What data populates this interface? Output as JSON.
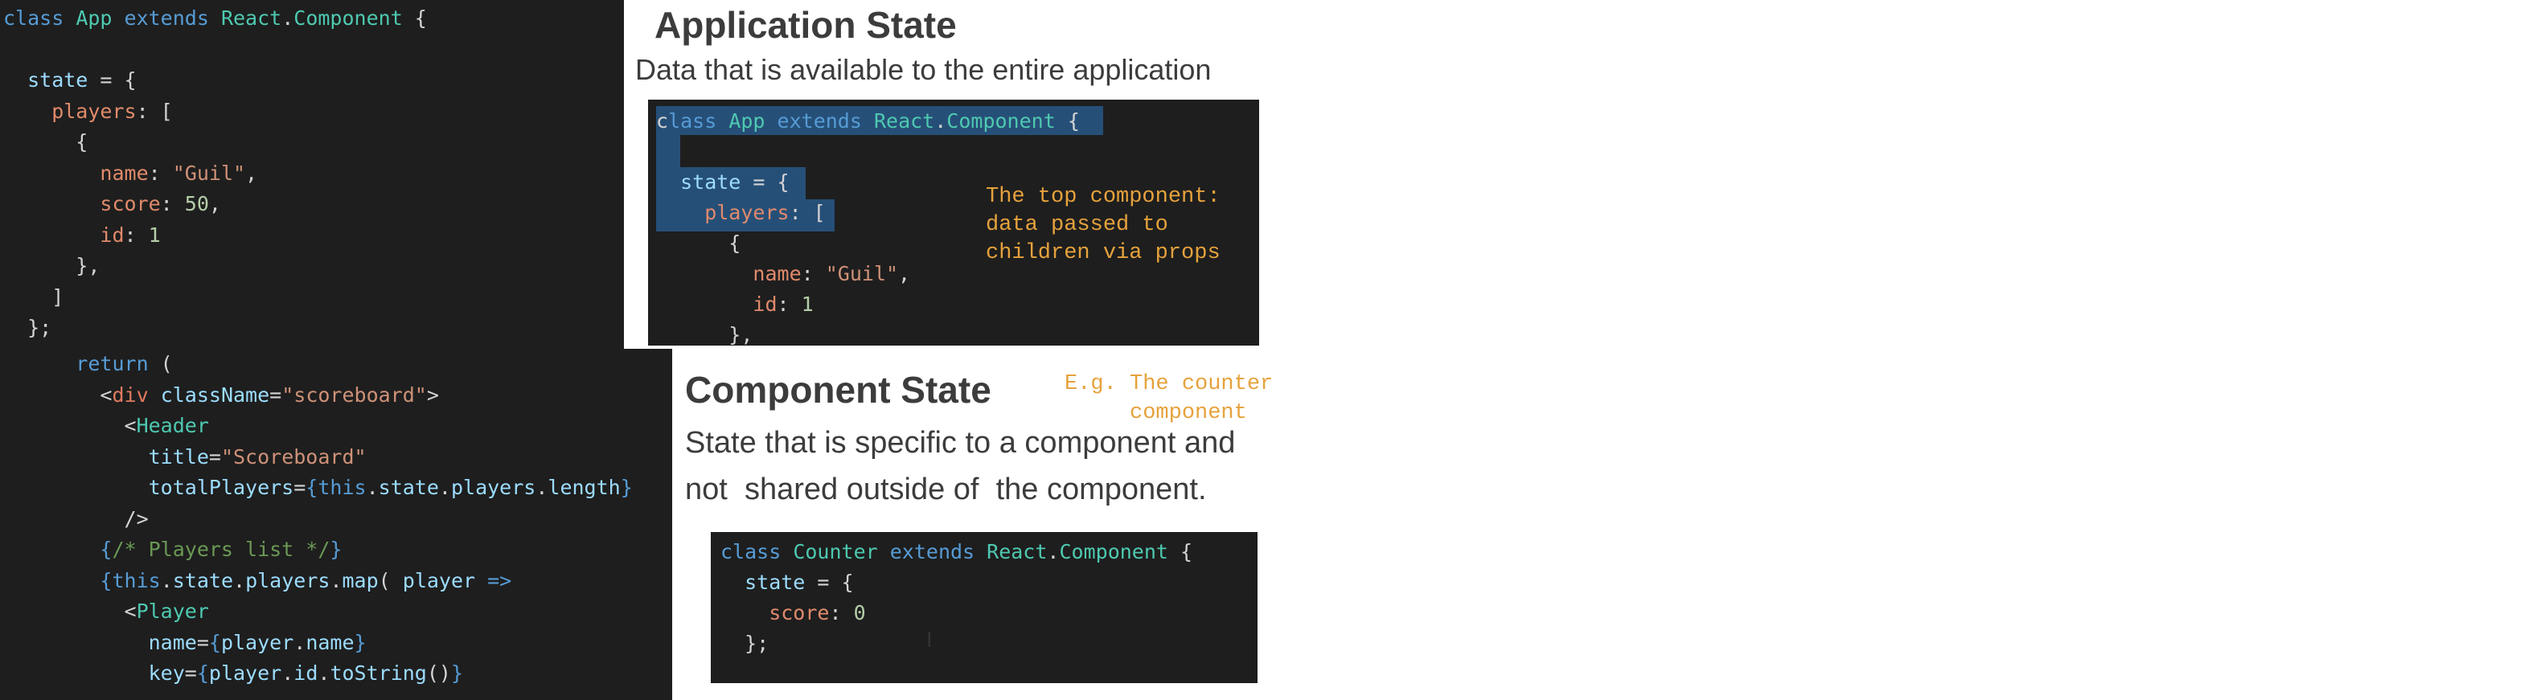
{
  "left_code": {
    "lines": [
      [
        [
          "kw",
          "class "
        ],
        [
          "cls",
          "App "
        ],
        [
          "kw",
          "extends "
        ],
        [
          "cls",
          "React"
        ],
        [
          "punc",
          "."
        ],
        [
          "cls",
          "Component "
        ],
        [
          "punc",
          "{"
        ]
      ],
      [],
      [
        [
          "var",
          "  state "
        ],
        [
          "punc",
          "= {"
        ]
      ],
      [
        [
          "prop",
          "    players"
        ],
        [
          "punc",
          ": ["
        ]
      ],
      [
        [
          "punc",
          "      {"
        ]
      ],
      [
        [
          "prop",
          "        name"
        ],
        [
          "punc",
          ": "
        ],
        [
          "str",
          "\"Guil\""
        ],
        [
          "punc",
          ","
        ]
      ],
      [
        [
          "prop",
          "        score"
        ],
        [
          "punc",
          ": "
        ],
        [
          "num",
          "50"
        ],
        [
          "punc",
          ","
        ]
      ],
      [
        [
          "prop",
          "        id"
        ],
        [
          "punc",
          ": "
        ],
        [
          "num",
          "1"
        ]
      ],
      [
        [
          "punc",
          "      },"
        ]
      ],
      [
        [
          "punc",
          "    ]"
        ]
      ],
      [
        [
          "punc",
          "  };"
        ]
      ]
    ],
    "lines_bottom": [
      [
        [
          "kw",
          "      return "
        ],
        [
          "punc",
          "("
        ]
      ],
      [
        [
          "punc",
          "        <"
        ],
        [
          "tag",
          "div "
        ],
        [
          "attr",
          "className"
        ],
        [
          "punc",
          "="
        ],
        [
          "str",
          "\"scoreboard\""
        ],
        [
          "punc",
          ">"
        ]
      ],
      [
        [
          "punc",
          "          <"
        ],
        [
          "cls",
          "Header"
        ]
      ],
      [
        [
          "attr",
          "            title"
        ],
        [
          "punc",
          "="
        ],
        [
          "str",
          "\"Scoreboard\""
        ]
      ],
      [
        [
          "attr",
          "            totalPlayers"
        ],
        [
          "punc",
          "="
        ],
        [
          "brace",
          "{"
        ],
        [
          "kw",
          "this"
        ],
        [
          "punc",
          "."
        ],
        [
          "var",
          "state"
        ],
        [
          "punc",
          "."
        ],
        [
          "var",
          "players"
        ],
        [
          "punc",
          "."
        ],
        [
          "var",
          "length"
        ],
        [
          "brace",
          "}"
        ]
      ],
      [
        [
          "punc",
          "          />"
        ]
      ],
      [
        [
          "brace",
          "        {"
        ],
        [
          "cm",
          "/* Players list */"
        ],
        [
          "brace",
          "}"
        ]
      ],
      [
        [
          "brace",
          "        {"
        ],
        [
          "kw",
          "this"
        ],
        [
          "punc",
          "."
        ],
        [
          "var",
          "state"
        ],
        [
          "punc",
          "."
        ],
        [
          "var",
          "players"
        ],
        [
          "punc",
          "."
        ],
        [
          "var",
          "map"
        ],
        [
          "punc",
          "( "
        ],
        [
          "var",
          "player "
        ],
        [
          "kw",
          "=>"
        ]
      ],
      [
        [
          "punc",
          "          <"
        ],
        [
          "cls",
          "Player"
        ]
      ],
      [
        [
          "attr",
          "            name"
        ],
        [
          "punc",
          "="
        ],
        [
          "brace",
          "{"
        ],
        [
          "var",
          "player"
        ],
        [
          "punc",
          "."
        ],
        [
          "var",
          "name"
        ],
        [
          "brace",
          "}"
        ]
      ],
      [
        [
          "attr",
          "            key"
        ],
        [
          "punc",
          "="
        ],
        [
          "brace",
          "{"
        ],
        [
          "var",
          "player"
        ],
        [
          "punc",
          "."
        ],
        [
          "var",
          "id"
        ],
        [
          "punc",
          "."
        ],
        [
          "var",
          "toString"
        ],
        [
          "punc",
          "()"
        ],
        [
          "brace",
          "}"
        ]
      ]
    ]
  },
  "application_state": {
    "title": "Application State",
    "description": "Data that is available to the entire application",
    "note": "The top component:\ndata passed to\nchildren via props",
    "snippet": [
      [
        [
          "punc",
          "c"
        ],
        [
          "kw",
          "lass "
        ],
        [
          "cls",
          "App "
        ],
        [
          "kw",
          "extends "
        ],
        [
          "cls",
          "React"
        ],
        [
          "punc",
          "."
        ],
        [
          "cls",
          "Component "
        ],
        [
          "punc",
          "{"
        ]
      ],
      [],
      [
        [
          "var",
          "  state "
        ],
        [
          "punc",
          "= {"
        ]
      ],
      [
        [
          "prop",
          "    players"
        ],
        [
          "punc",
          ": ["
        ]
      ],
      [
        [
          "punc",
          "      {"
        ]
      ],
      [
        [
          "prop",
          "        name"
        ],
        [
          "punc",
          ": "
        ],
        [
          "str",
          "\"Guil\""
        ],
        [
          "punc",
          ","
        ]
      ],
      [
        [
          "prop",
          "        id"
        ],
        [
          "punc",
          ": "
        ],
        [
          "num",
          "1"
        ]
      ],
      [
        [
          "punc",
          "      },"
        ]
      ]
    ]
  },
  "component_state": {
    "title": "Component State",
    "note": "E.g. The counter\n     component",
    "description_line1": "State that is specific to a component and",
    "description_line2": "not  shared outside of  the component.",
    "snippet": [
      [
        [
          "kw",
          "class "
        ],
        [
          "cls",
          "Counter "
        ],
        [
          "kw",
          "extends "
        ],
        [
          "cls",
          "React"
        ],
        [
          "punc",
          "."
        ],
        [
          "cls",
          "Component "
        ],
        [
          "punc",
          "{"
        ]
      ],
      [
        [
          "var",
          "  state "
        ],
        [
          "punc",
          "= {"
        ]
      ],
      [
        [
          "prop",
          "    score"
        ],
        [
          "punc",
          ": "
        ],
        [
          "num",
          "0"
        ]
      ],
      [
        [
          "punc",
          "  };"
        ]
      ]
    ]
  },
  "icons": {
    "cursor": "text-cursor-icon"
  },
  "colors": {
    "editor_bg": "#1e1e1e",
    "note": "#e6a23c",
    "selection": "#264f78"
  }
}
